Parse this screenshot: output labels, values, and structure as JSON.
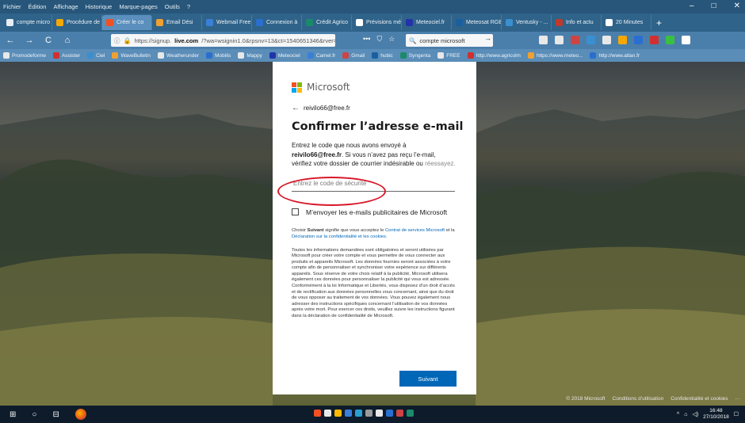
{
  "browser": {
    "menu": [
      "Fichier",
      "Édition",
      "Affichage",
      "Historique",
      "Marque-pages",
      "Outils",
      "?"
    ],
    "window_controls": [
      "–",
      "□",
      "✕"
    ],
    "tabs": [
      {
        "label": "compte micro",
        "color": "#e8eef4",
        "active": false
      },
      {
        "label": "Procédure de",
        "color": "#f6a800",
        "active": false
      },
      {
        "label": "Créer le co",
        "color": "#f25022",
        "active": true
      },
      {
        "label": "Email Dési",
        "color": "#f0a030",
        "active": false
      },
      {
        "label": "Webmail Free",
        "color": "#3a7fd8",
        "active": false
      },
      {
        "label": "Connexion à",
        "color": "#2a6fd0",
        "active": false
      },
      {
        "label": "Crédit Agrico",
        "color": "#1b8a6b",
        "active": false
      },
      {
        "label": "Prévisions mé",
        "color": "#ffffff",
        "active": false
      },
      {
        "label": "Meteociel.fr",
        "color": "#2233aa",
        "active": false
      },
      {
        "label": "Meteosat RGB",
        "color": "#1a5fa0",
        "active": false
      },
      {
        "label": "Ventusky - ...",
        "color": "#3a8fd0",
        "active": false
      },
      {
        "label": "Info et actu",
        "color": "#c0392b",
        "active": false
      },
      {
        "label": "20 Minutes",
        "color": "#ffffff",
        "active": false
      }
    ],
    "tab_add": "+",
    "nav": {
      "back": "←",
      "forward": "→",
      "reload": "C",
      "home": "⌂"
    },
    "url": {
      "prefix": "https://signup.",
      "host": "live.com",
      "rest": "/?wa=wsignin1.0&rpsnv=13&ct=1540651346&rver="
    },
    "url_actions": [
      "•••",
      "⛉",
      "☆"
    ],
    "search": {
      "value": "compte microsoft",
      "arrow": "→"
    },
    "bookmarks": [
      "Promodeforme",
      "Assister",
      "Ciel",
      "WaveBulletin",
      "Weatherunder",
      "Mobilis",
      "Mappy",
      "Meteociel",
      "Camel.fr",
      "Gmail",
      "hubic",
      "Syngenta",
      "FREE",
      "http://www.agricolm",
      "https://www.meteo...",
      "http://www.atlan.fr"
    ],
    "toolbar_icon_colors": [
      "#e8e8e8",
      "#e8e8e8",
      "#c44",
      "#3a8fd0",
      "#e8e8e8",
      "#f6a800",
      "#2a6fd0",
      "#d03030",
      "#3ac040",
      "#fff"
    ]
  },
  "dialog": {
    "brand": "Microsoft",
    "logo_colors": [
      "#f25022",
      "#7fba00",
      "#00a4ef",
      "#ffb900"
    ],
    "back_arrow": "←",
    "email": "reivilo66@free.fr",
    "heading": "Confirmer l’adresse e-mail",
    "desc_intro": "Entrez le code que nous avons envoyé à",
    "desc_email": "reivilo66@free.fr",
    "desc_rest": ". Si vous n’avez pas reçu l’e-mail, vérifiez votre dossier de courrier indésirable ou",
    "desc_partial": "réessayez.",
    "code_placeholder": "Entrez le code de sécurité",
    "checkbox_label": "M’envoyer les e-mails publicitaires de Microsoft",
    "legal_intro": "Choisir",
    "legal_bold": "Suivant",
    "legal_mid": "signifie que vous acceptez le",
    "legal_link1": "Contrat de services Microsoft",
    "legal_and": "et la",
    "legal_link2": "Déclaration sur la confidentialité et les cookies.",
    "legal_body": "Toutes les informations demandées sont obligatoires et seront utilisées par Microsoft pour créer votre compte et vous permettre de vous connecter aux produits et appareils Microsoft. Les données fournies seront associées à votre compte afin de personnaliser et synchroniser votre expérience sur différents appareils. Sous réserve de votre choix relatif à la publicité, Microsoft utilisera également ces données pour personnaliser la publicité qui vous est adressée. Conformément à la loi Informatique et Libertés, vous disposez d’un droit d’accès et de rectification aux données personnelles vous concernant, ainsi que du droit de vous opposer au traitement de vos données. Vous pouvez également nous adresser des instructions spécifiques concernant l’utilisation de vos données après votre mort. Pour exercer ces droits, veuillez suivre les instructions figurant dans la déclaration de confidentialité de Microsoft.",
    "next_button": "Suivant",
    "highlight_color": "#d8182a"
  },
  "footer": {
    "copyright": "© 2018 Microsoft",
    "terms": "Conditions d’utilisation",
    "privacy": "Confidentialité et cookies",
    "more": "···"
  },
  "taskbar": {
    "start": "⊞",
    "search": "○",
    "taskview": "⊟",
    "tray_chevron": "^",
    "time": "16:48",
    "date": "27/10/2018",
    "notif": "☐",
    "middle_icon_colors": [
      "#f25022",
      "#e8e8e8",
      "#ffb900",
      "#3a7fd8",
      "#2a9fd0",
      "#9a9a9a",
      "#e8e8e8",
      "#2a6fd0",
      "#c44",
      "#1b8a6b"
    ]
  }
}
